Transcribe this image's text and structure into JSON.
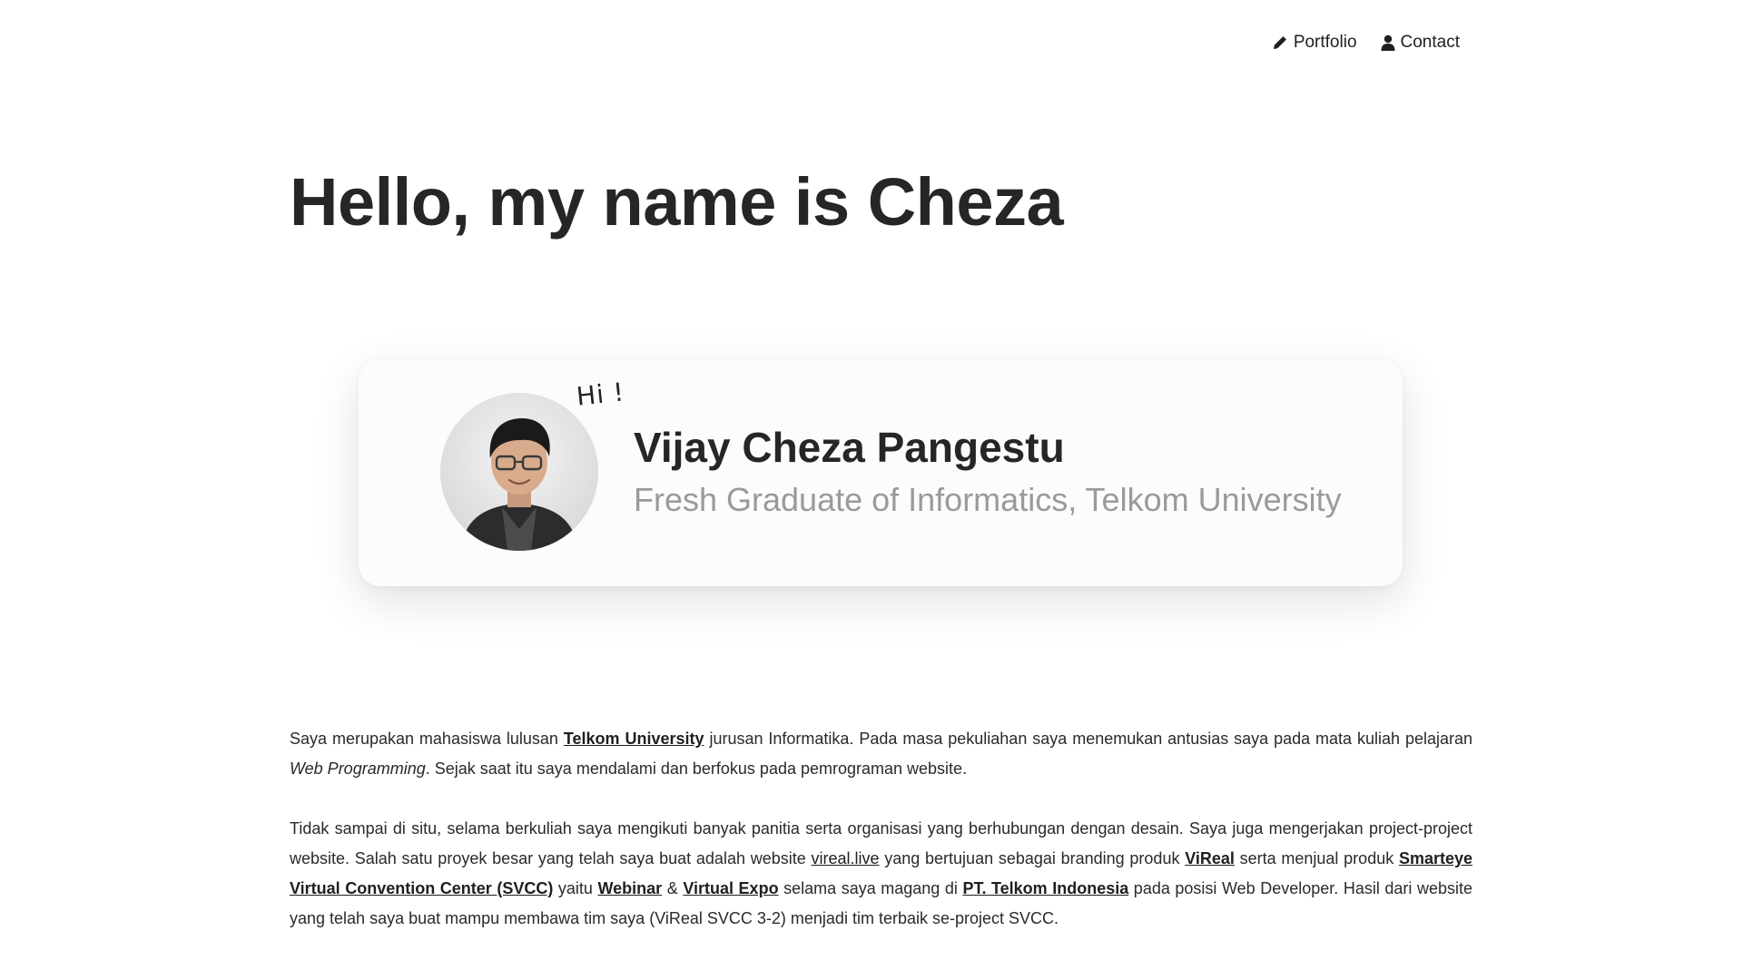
{
  "nav": {
    "portfolio_label": "Portfolio",
    "portfolio_icon": "pencil-icon",
    "contact_label": "Contact",
    "contact_icon": "user-icon"
  },
  "hero": {
    "title": "Hello, my name is Cheza"
  },
  "profile_card": {
    "greeting": "Hi !",
    "name": "Vijay Cheza Pangestu",
    "subtitle": "Fresh Graduate of Informatics, Telkom University",
    "avatar": "profile-photo"
  },
  "about": {
    "p1": {
      "t1": "Saya merupakan mahasiswa lulusan ",
      "link_telkom_university": "Telkom University",
      "t2": " jurusan Informatika. Pada masa pekuliahan saya menemukan antusias saya pada mata kuliah pelajaran ",
      "em_web_programming": "Web Programming",
      "t3": ". Sejak saat itu saya mendalami dan berfokus pada pemrograman website."
    },
    "p2": {
      "t1": "Tidak sampai di situ, selama berkuliah saya mengikuti banyak panitia serta organisasi yang berhubungan dengan desain. Saya juga mengerjakan project-project website. Salah satu proyek besar yang telah saya buat adalah website ",
      "link_vireal_live": "vireal.live",
      "t2": " yang bertujuan sebagai branding produk ",
      "link_vireal": "ViReal",
      "t3": " serta menjual produk ",
      "link_svcc": "Smarteye Virtual Convention Center (SVCC)",
      "t4": " yaitu ",
      "link_webinar": "Webinar",
      "t5": " & ",
      "link_virtual_expo": "Virtual Expo",
      "t6": " selama saya magang di ",
      "link_telkom_indonesia": "PT. Telkom Indonesia",
      "t7": " pada posisi Web Developer. Hasil dari website yang telah saya buat mampu membawa tim saya (ViReal SVCC 3-2) menjadi tim terbaik se-project SVCC."
    }
  }
}
